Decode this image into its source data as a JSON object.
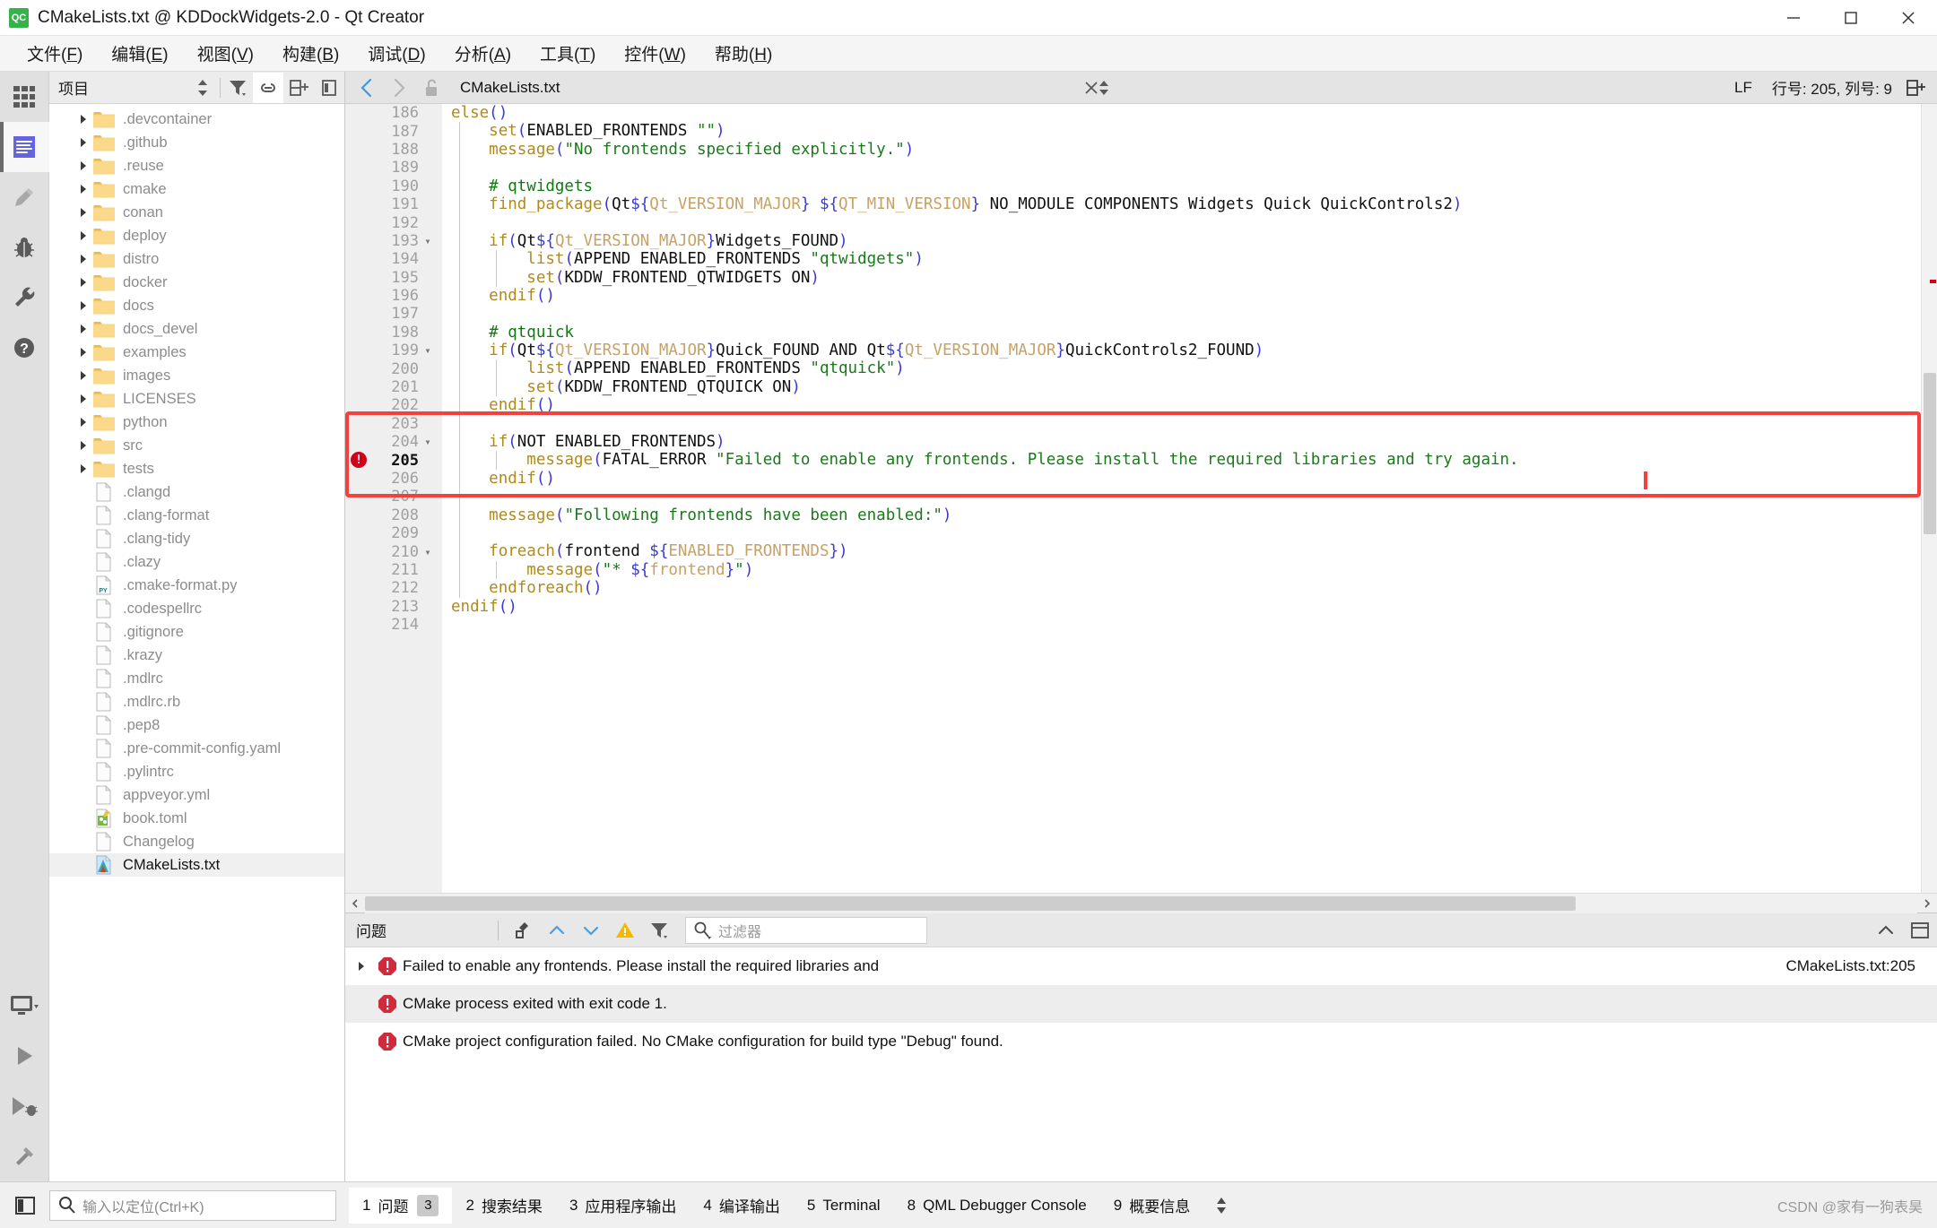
{
  "window": {
    "title": "CMakeLists.txt @ KDDockWidgets-2.0 - Qt Creator",
    "app_badge": "QC",
    "minimize": "minimize",
    "maximize": "maximize",
    "close": "close"
  },
  "menubar": [
    {
      "label": "文件(F)"
    },
    {
      "label": "编辑(E)"
    },
    {
      "label": "视图(V)"
    },
    {
      "label": "构建(B)"
    },
    {
      "label": "调试(D)"
    },
    {
      "label": "分析(A)"
    },
    {
      "label": "工具(T)"
    },
    {
      "label": "控件(W)"
    },
    {
      "label": "帮助(H)"
    }
  ],
  "modebar": [
    {
      "name": "welcome-mode",
      "icon": "grid-icon"
    },
    {
      "name": "edit-mode",
      "icon": "document-lines-icon",
      "active": true
    },
    {
      "name": "design-mode",
      "icon": "pencil-icon"
    },
    {
      "name": "debug-mode",
      "icon": "bug-icon"
    },
    {
      "name": "projects-mode",
      "icon": "wrench-icon"
    },
    {
      "name": "help-mode",
      "icon": "question-circle-icon"
    },
    {
      "name": "kit-selector",
      "icon": "monitor-icon"
    },
    {
      "name": "run-button",
      "icon": "play-icon"
    },
    {
      "name": "debug-run-button",
      "icon": "play-bug-icon"
    },
    {
      "name": "build-button",
      "icon": "hammer-icon"
    }
  ],
  "sidebar": {
    "title": "项目",
    "tools": [
      {
        "name": "filter-button",
        "icon": "filter-icon"
      },
      {
        "name": "link-with-editor-button",
        "icon": "link-icon"
      },
      {
        "name": "split-button",
        "icon": "split-add-icon"
      },
      {
        "name": "close-sidebar-button",
        "icon": "panel-close-icon"
      }
    ],
    "tree": [
      {
        "label": ".devcontainer",
        "type": "folder"
      },
      {
        "label": ".github",
        "type": "folder"
      },
      {
        "label": ".reuse",
        "type": "folder"
      },
      {
        "label": "cmake",
        "type": "folder"
      },
      {
        "label": "conan",
        "type": "folder"
      },
      {
        "label": "deploy",
        "type": "folder"
      },
      {
        "label": "distro",
        "type": "folder"
      },
      {
        "label": "docker",
        "type": "folder"
      },
      {
        "label": "docs",
        "type": "folder"
      },
      {
        "label": "docs_devel",
        "type": "folder"
      },
      {
        "label": "examples",
        "type": "folder"
      },
      {
        "label": "images",
        "type": "folder"
      },
      {
        "label": "LICENSES",
        "type": "folder"
      },
      {
        "label": "python",
        "type": "folder"
      },
      {
        "label": "src",
        "type": "folder"
      },
      {
        "label": "tests",
        "type": "folder"
      },
      {
        "label": ".clangd",
        "type": "file"
      },
      {
        "label": ".clang-format",
        "type": "file"
      },
      {
        "label": ".clang-tidy",
        "type": "file"
      },
      {
        "label": ".clazy",
        "type": "file"
      },
      {
        "label": ".cmake-format.py",
        "type": "py"
      },
      {
        "label": ".codespellrc",
        "type": "file"
      },
      {
        "label": ".gitignore",
        "type": "file"
      },
      {
        "label": ".krazy",
        "type": "file"
      },
      {
        "label": ".mdlrc",
        "type": "file"
      },
      {
        "label": ".mdlrc.rb",
        "type": "file"
      },
      {
        "label": ".pep8",
        "type": "file"
      },
      {
        "label": ".pre-commit-config.yaml",
        "type": "file"
      },
      {
        "label": ".pylintrc",
        "type": "file"
      },
      {
        "label": "appveyor.yml",
        "type": "file"
      },
      {
        "label": "book.toml",
        "type": "toml"
      },
      {
        "label": "Changelog",
        "type": "file"
      },
      {
        "label": "CMakeLists.txt",
        "type": "cmake",
        "selected": true
      }
    ]
  },
  "editor": {
    "back_button": "back",
    "forward_button": "forward",
    "lock_button": "unlocked",
    "document_name": "CMakeLists.txt",
    "close_button": "close-document",
    "line_ending": "LF",
    "cursor_position": "行号: 205, 列号: 9",
    "split_button": "split-editor",
    "lines": [
      {
        "n": "186",
        "fold": "",
        "indent": 0,
        "tokens": [
          {
            "t": "else",
            "c": "kw"
          },
          {
            "t": "()",
            "c": "brc"
          }
        ]
      },
      {
        "n": "187",
        "fold": "",
        "indent": 1,
        "tokens": [
          {
            "t": "    ",
            "c": ""
          },
          {
            "t": "set",
            "c": "kw"
          },
          {
            "t": "(",
            "c": "brc"
          },
          {
            "t": "ENABLED_FRONTENDS ",
            "c": "ident"
          },
          {
            "t": "\"\"",
            "c": "str"
          },
          {
            "t": ")",
            "c": "brc"
          }
        ]
      },
      {
        "n": "188",
        "fold": "",
        "indent": 1,
        "tokens": [
          {
            "t": "    ",
            "c": ""
          },
          {
            "t": "message",
            "c": "kw"
          },
          {
            "t": "(",
            "c": "brc"
          },
          {
            "t": "\"No frontends specified explicitly.\"",
            "c": "str"
          },
          {
            "t": ")",
            "c": "brc"
          }
        ]
      },
      {
        "n": "189",
        "fold": "",
        "indent": 1,
        "tokens": []
      },
      {
        "n": "190",
        "fold": "",
        "indent": 1,
        "tokens": [
          {
            "t": "    # qtwidgets",
            "c": "cmt"
          }
        ]
      },
      {
        "n": "191",
        "fold": "",
        "indent": 1,
        "tokens": [
          {
            "t": "    ",
            "c": ""
          },
          {
            "t": "find_package",
            "c": "kw"
          },
          {
            "t": "(",
            "c": "brc"
          },
          {
            "t": "Qt",
            "c": "ident"
          },
          {
            "t": "${",
            "c": "brc"
          },
          {
            "t": "Qt_VERSION_MAJOR",
            "c": "var"
          },
          {
            "t": "}",
            "c": "brc"
          },
          {
            "t": " ",
            "c": ""
          },
          {
            "t": "${",
            "c": "brc"
          },
          {
            "t": "QT_MIN_VERSION",
            "c": "var"
          },
          {
            "t": "}",
            "c": "brc"
          },
          {
            "t": " NO_MODULE COMPONENTS Widgets Quick QuickControls2",
            "c": "ident"
          },
          {
            "t": ")",
            "c": "brc"
          }
        ]
      },
      {
        "n": "192",
        "fold": "",
        "indent": 1,
        "tokens": []
      },
      {
        "n": "193",
        "fold": "▾",
        "indent": 1,
        "tokens": [
          {
            "t": "    ",
            "c": ""
          },
          {
            "t": "if",
            "c": "kw"
          },
          {
            "t": "(",
            "c": "brc"
          },
          {
            "t": "Qt",
            "c": "ident"
          },
          {
            "t": "${",
            "c": "brc"
          },
          {
            "t": "Qt_VERSION_MAJOR",
            "c": "var"
          },
          {
            "t": "}",
            "c": "brc"
          },
          {
            "t": "Widgets_FOUND",
            "c": "ident"
          },
          {
            "t": ")",
            "c": "brc"
          }
        ]
      },
      {
        "n": "194",
        "fold": "",
        "indent": 2,
        "tokens": [
          {
            "t": "        ",
            "c": ""
          },
          {
            "t": "list",
            "c": "kw"
          },
          {
            "t": "(",
            "c": "brc"
          },
          {
            "t": "APPEND ENABLED_FRONTENDS ",
            "c": "ident"
          },
          {
            "t": "\"qtwidgets\"",
            "c": "str"
          },
          {
            "t": ")",
            "c": "brc"
          }
        ]
      },
      {
        "n": "195",
        "fold": "",
        "indent": 2,
        "tokens": [
          {
            "t": "        ",
            "c": ""
          },
          {
            "t": "set",
            "c": "kw"
          },
          {
            "t": "(",
            "c": "brc"
          },
          {
            "t": "KDDW_FRONTEND_QTWIDGETS ON",
            "c": "ident"
          },
          {
            "t": ")",
            "c": "brc"
          }
        ]
      },
      {
        "n": "196",
        "fold": "",
        "indent": 1,
        "tokens": [
          {
            "t": "    ",
            "c": ""
          },
          {
            "t": "endif",
            "c": "kw"
          },
          {
            "t": "()",
            "c": "brc"
          }
        ]
      },
      {
        "n": "197",
        "fold": "",
        "indent": 1,
        "tokens": []
      },
      {
        "n": "198",
        "fold": "",
        "indent": 1,
        "tokens": [
          {
            "t": "    # qtquick",
            "c": "cmt"
          }
        ]
      },
      {
        "n": "199",
        "fold": "▾",
        "indent": 1,
        "tokens": [
          {
            "t": "    ",
            "c": ""
          },
          {
            "t": "if",
            "c": "kw"
          },
          {
            "t": "(",
            "c": "brc"
          },
          {
            "t": "Qt",
            "c": "ident"
          },
          {
            "t": "${",
            "c": "brc"
          },
          {
            "t": "Qt_VERSION_MAJOR",
            "c": "var"
          },
          {
            "t": "}",
            "c": "brc"
          },
          {
            "t": "Quick_FOUND",
            "c": "ident"
          },
          {
            "t": " AND ",
            "c": "ident"
          },
          {
            "t": "Qt",
            "c": "ident"
          },
          {
            "t": "${",
            "c": "brc"
          },
          {
            "t": "Qt_VERSION_MAJOR",
            "c": "var"
          },
          {
            "t": "}",
            "c": "brc"
          },
          {
            "t": "QuickControls2_FOUND",
            "c": "ident"
          },
          {
            "t": ")",
            "c": "brc"
          }
        ]
      },
      {
        "n": "200",
        "fold": "",
        "indent": 2,
        "tokens": [
          {
            "t": "        ",
            "c": ""
          },
          {
            "t": "list",
            "c": "kw"
          },
          {
            "t": "(",
            "c": "brc"
          },
          {
            "t": "APPEND ENABLED_FRONTENDS ",
            "c": "ident"
          },
          {
            "t": "\"qtquick\"",
            "c": "str"
          },
          {
            "t": ")",
            "c": "brc"
          }
        ]
      },
      {
        "n": "201",
        "fold": "",
        "indent": 2,
        "tokens": [
          {
            "t": "        ",
            "c": ""
          },
          {
            "t": "set",
            "c": "kw"
          },
          {
            "t": "(",
            "c": "brc"
          },
          {
            "t": "KDDW_FRONTEND_QTQUICK ON",
            "c": "ident"
          },
          {
            "t": ")",
            "c": "brc"
          }
        ]
      },
      {
        "n": "202",
        "fold": "",
        "indent": 1,
        "tokens": [
          {
            "t": "    ",
            "c": ""
          },
          {
            "t": "endif",
            "c": "kw"
          },
          {
            "t": "()",
            "c": "brc"
          }
        ]
      },
      {
        "n": "203",
        "fold": "",
        "indent": 1,
        "tokens": []
      },
      {
        "n": "204",
        "fold": "▾",
        "indent": 1,
        "tokens": [
          {
            "t": "    ",
            "c": ""
          },
          {
            "t": "if",
            "c": "kw"
          },
          {
            "t": "(",
            "c": "brc"
          },
          {
            "t": "NOT ENABLED_FRONTENDS",
            "c": "ident"
          },
          {
            "t": ")",
            "c": "brc"
          }
        ]
      },
      {
        "n": "205",
        "fold": "",
        "indent": 2,
        "error": true,
        "tokens": [
          {
            "t": "        ",
            "c": ""
          },
          {
            "t": "message",
            "c": "kw"
          },
          {
            "t": "(",
            "c": "brc"
          },
          {
            "t": "FATAL_ERROR ",
            "c": "ident"
          },
          {
            "t": "\"Failed to enable any frontends. Please install the required libraries and try again.",
            "c": "str"
          }
        ]
      },
      {
        "n": "206",
        "fold": "",
        "indent": 1,
        "tokens": [
          {
            "t": "    ",
            "c": ""
          },
          {
            "t": "endif",
            "c": "kw"
          },
          {
            "t": "()",
            "c": "brc"
          }
        ]
      },
      {
        "n": "207",
        "fold": "",
        "indent": 1,
        "tokens": []
      },
      {
        "n": "208",
        "fold": "",
        "indent": 1,
        "tokens": [
          {
            "t": "    ",
            "c": ""
          },
          {
            "t": "message",
            "c": "kw"
          },
          {
            "t": "(",
            "c": "brc"
          },
          {
            "t": "\"Following frontends have been enabled:\"",
            "c": "str"
          },
          {
            "t": ")",
            "c": "brc"
          }
        ]
      },
      {
        "n": "209",
        "fold": "",
        "indent": 1,
        "tokens": []
      },
      {
        "n": "210",
        "fold": "▾",
        "indent": 1,
        "tokens": [
          {
            "t": "    ",
            "c": ""
          },
          {
            "t": "foreach",
            "c": "kw"
          },
          {
            "t": "(",
            "c": "brc"
          },
          {
            "t": "frontend ",
            "c": "ident"
          },
          {
            "t": "${",
            "c": "brc"
          },
          {
            "t": "ENABLED_FRONTENDS",
            "c": "var"
          },
          {
            "t": "}",
            "c": "brc"
          },
          {
            "t": ")",
            "c": "brc"
          }
        ]
      },
      {
        "n": "211",
        "fold": "",
        "indent": 2,
        "tokens": [
          {
            "t": "        ",
            "c": ""
          },
          {
            "t": "message",
            "c": "kw"
          },
          {
            "t": "(",
            "c": "brc"
          },
          {
            "t": "\"* ",
            "c": "str"
          },
          {
            "t": "${",
            "c": "brc"
          },
          {
            "t": "frontend",
            "c": "var"
          },
          {
            "t": "}",
            "c": "brc"
          },
          {
            "t": "\"",
            "c": "str"
          },
          {
            "t": ")",
            "c": "brc"
          }
        ]
      },
      {
        "n": "212",
        "fold": "",
        "indent": 1,
        "tokens": [
          {
            "t": "    ",
            "c": ""
          },
          {
            "t": "endforeach",
            "c": "kw"
          },
          {
            "t": "()",
            "c": "brc"
          }
        ]
      },
      {
        "n": "213",
        "fold": "",
        "indent": 0,
        "tokens": [
          {
            "t": "endif",
            "c": "kw"
          },
          {
            "t": "()",
            "c": "brc"
          }
        ]
      },
      {
        "n": "214",
        "fold": "",
        "indent": 0,
        "tokens": []
      }
    ]
  },
  "issues_panel": {
    "title": "问题",
    "filter_placeholder": "过滤器",
    "toolbar": [
      {
        "name": "clear-button",
        "icon": "broom-icon"
      },
      {
        "name": "previous-issue-button",
        "icon": "chevron-up-icon"
      },
      {
        "name": "next-issue-button",
        "icon": "chevron-down-icon"
      },
      {
        "name": "warning-filter-button",
        "icon": "warning-triangle-icon"
      },
      {
        "name": "filter-button",
        "icon": "filter-icon"
      },
      {
        "name": "search-icon",
        "icon": "magnifier-icon"
      }
    ],
    "right_tools": [
      {
        "name": "collapse-panel-button",
        "icon": "chevron-up-icon"
      },
      {
        "name": "maximize-panel-button",
        "icon": "panel-maximize-icon"
      }
    ],
    "rows": [
      {
        "severity": "error",
        "expandable": true,
        "text": "Failed to enable any frontends.  Please install the required libraries and",
        "location": "CMakeLists.txt:205"
      },
      {
        "severity": "error",
        "expandable": false,
        "text": "CMake process exited with exit code 1.",
        "location": ""
      },
      {
        "severity": "error",
        "expandable": false,
        "text": "CMake project configuration failed. No CMake configuration for build type \"Debug\" found.",
        "location": ""
      }
    ]
  },
  "statusbar": {
    "toggle_sidebar": "toggle-sidebar",
    "locator_placeholder": "输入以定位(Ctrl+K)",
    "output_tabs": [
      {
        "num": "1",
        "label": "问题",
        "badge": "3",
        "active": true
      },
      {
        "num": "2",
        "label": "搜索结果",
        "badge": "",
        "active": false
      },
      {
        "num": "3",
        "label": "应用程序输出",
        "badge": "",
        "active": false
      },
      {
        "num": "4",
        "label": "编译输出",
        "badge": "",
        "active": false
      },
      {
        "num": "5",
        "label": "Terminal",
        "badge": "",
        "active": false
      },
      {
        "num": "8",
        "label": "QML Debugger Console",
        "badge": "",
        "active": false
      },
      {
        "num": "9",
        "label": "概要信息",
        "badge": "",
        "active": false
      }
    ],
    "watermark": "CSDN @家有一狗表昊"
  },
  "colors": {
    "accent": "#6464e0",
    "error_red": "#d0021b",
    "annotation_red": "#f5403b",
    "folder_yellow": "#f2c14e",
    "string_green": "#1a7a1a",
    "keyword_gold": "#b08a1e"
  }
}
